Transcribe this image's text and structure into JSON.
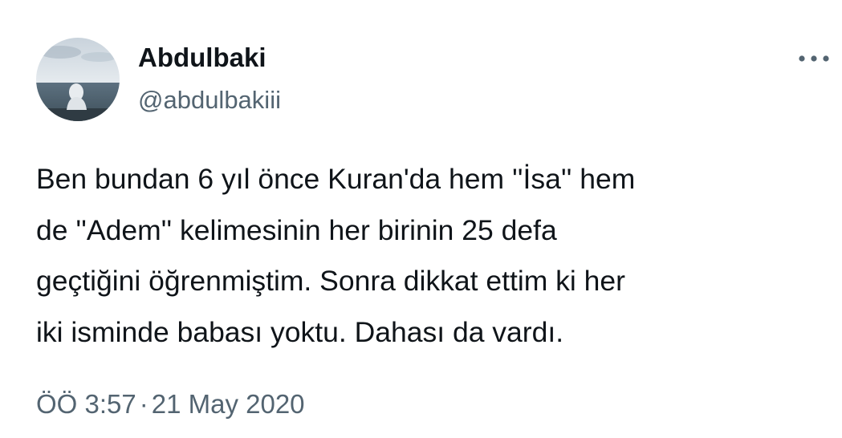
{
  "author": {
    "display_name": "Abdulbaki",
    "handle": "@abdulbakiii",
    "avatar": "avatar-photo-person-by-sea"
  },
  "menu": {
    "icon": "more-horizontal-icon"
  },
  "tweet": {
    "text_lines": [
      "Ben bundan 6 yıl önce Kuran'da hem ''İsa'' hem",
      "de ''Adem'' kelimesinin her birinin 25 defa",
      "geçtiğini öğrenmiştim. Sonra dikkat ettim ki her",
      "iki isminde babası yoktu. Dahası da vardı."
    ],
    "time": "ÖÖ 3:57",
    "separator": "·",
    "date": "21 May 2020"
  },
  "colors": {
    "primary_text": "#0f1419",
    "secondary_text": "#536471",
    "background": "#ffffff"
  }
}
